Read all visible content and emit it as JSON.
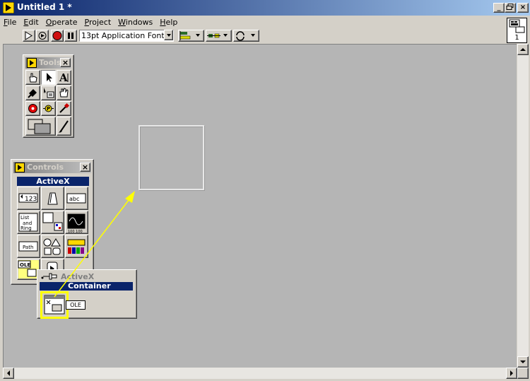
{
  "window": {
    "title": "Untitled 1 *",
    "buttons": {
      "minimize": "_",
      "restore": "6",
      "close": "×"
    }
  },
  "menu": [
    "File",
    "Edit",
    "Operate",
    "Project",
    "Windows",
    "Help"
  ],
  "menu_hotkeys": [
    "F",
    "E",
    "O",
    "P",
    "W",
    "H"
  ],
  "toolbar": {
    "font": "13pt Application Font"
  },
  "connector_pane": {
    "number": "1"
  },
  "tools_palette": {
    "title": "Tools",
    "close": "×",
    "tools": [
      "operate-value",
      "position-select",
      "edit-text",
      "connect-wire",
      "object-shortcut-menu",
      "scroll-window",
      "set-clear-breakpoint",
      "probe-data",
      "get-color",
      "set-color"
    ]
  },
  "controls_palette": {
    "title": "Controls",
    "close": "×",
    "subpalette_title": "ActiveX",
    "cells": [
      {
        "name": "numeric",
        "label": "123"
      },
      {
        "name": "boolean",
        "label": ""
      },
      {
        "name": "string",
        "label": "abc"
      },
      {
        "name": "list-and-ring",
        "label": "List and Ring"
      },
      {
        "name": "array-cluster",
        "label": ""
      },
      {
        "name": "graph",
        "label": "100 100"
      },
      {
        "name": "path",
        "label": "Path"
      },
      {
        "name": "decorations",
        "label": ""
      },
      {
        "name": "refnum",
        "label": ""
      },
      {
        "name": "activex",
        "label": "OLE"
      },
      {
        "name": "user-controls",
        "label": ""
      }
    ]
  },
  "activex_popup": {
    "header": "ActiveX",
    "selected_title": "Container",
    "item_label": "OLE"
  },
  "colors": {
    "titlebar_start": "#0a246a",
    "titlebar_end": "#a6caf0",
    "canvas": "#b5b5b5",
    "highlight": "#ffff00"
  }
}
